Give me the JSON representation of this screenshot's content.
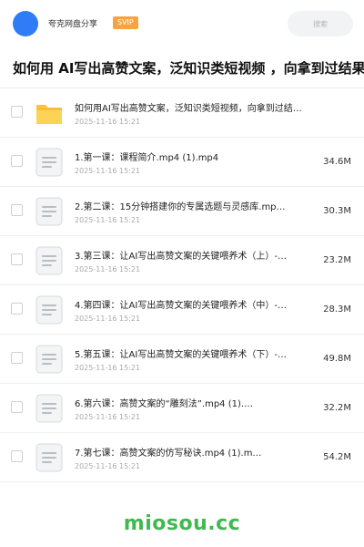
{
  "header": {
    "brand": "夸克网盘分享",
    "badge": "SVIP",
    "search_placeholder": "搜索"
  },
  "title": "如何用 AI写出高赞文案，泛知识类短视频 ，向拿到过结果的",
  "colors": {
    "avatar": "#2f7cf6",
    "badge": "#f7a440",
    "folder": "#fbc53b",
    "watermark": "#3fb950"
  },
  "items": [
    {
      "type": "folder",
      "icon": "folder-icon",
      "name": "如何用AI写出高赞文案，泛知识类短视频，向拿到过结…",
      "date": "2025-11-16 15:21",
      "size": ""
    },
    {
      "type": "file",
      "icon": "file-icon",
      "name": "1.第一课：课程简介.mp4 (1).mp4",
      "date": "2025-11-16 15:21",
      "size": "34.6M"
    },
    {
      "type": "file",
      "icon": "file-icon",
      "name": "2.第二课：15分钟搭建你的专属选题与灵感库.mp…",
      "date": "2025-11-16 15:21",
      "size": "30.3M"
    },
    {
      "type": "file",
      "icon": "file-icon",
      "name": "3.第三课：让AI写出高赞文案的关键喂养术（上）-…",
      "date": "2025-11-16 15:21",
      "size": "23.2M"
    },
    {
      "type": "file",
      "icon": "file-icon",
      "name": "4.第四课：让AI写出高赞文案的关键喂养术（中）-…",
      "date": "2025-11-16 15:21",
      "size": "28.3M"
    },
    {
      "type": "file",
      "icon": "file-icon",
      "name": "5.第五课：让AI写出高赞文案的关键喂养术（下）-…",
      "date": "2025-11-16 15:21",
      "size": "49.8M"
    },
    {
      "type": "file",
      "icon": "file-icon",
      "name": "6.第六课：高赞文案的“雕刻法”.mp4 (1).…",
      "date": "2025-11-16 15:21",
      "size": "32.2M"
    },
    {
      "type": "file",
      "icon": "file-icon",
      "name": "7.第七课：高赞文案的仿写秘诀.mp4 (1).m…",
      "date": "2025-11-16 15:21",
      "size": "54.2M"
    }
  ],
  "watermark": "miosou.cc"
}
